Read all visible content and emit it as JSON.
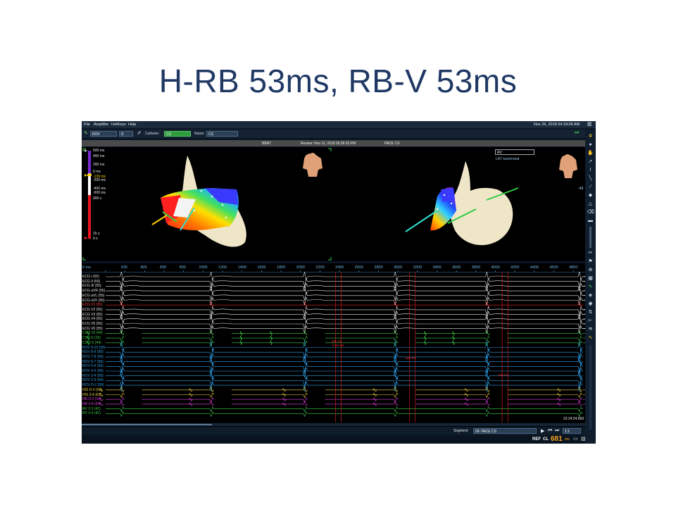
{
  "slide": {
    "title": "H-RB 53ms, RB-V 53ms"
  },
  "menu": {
    "items": [
      "File",
      "Amplifier",
      "HotKeys",
      "Help"
    ],
    "datetime": "Nov 26, 2018 04:18:06 AM"
  },
  "toolbar": {
    "catheter_select": "ROV",
    "mode_select": "D",
    "catheter_label": "Catheter:",
    "catheter_value": "CS",
    "name_label": "Name:",
    "name_value": "CS"
  },
  "infobar": {
    "map_name": "BBRT",
    "review": "Review: Nov 11, 2018 06:36:25 PM",
    "pace": "PACE CS"
  },
  "map_view": {
    "right_select": "RV",
    "right_mode": "LAT Isochronal",
    "scale_labels": [
      "500 ms",
      "400 ms",
      "200 ms",
      "0 ms",
      "-139 ms",
      "-200 ms",
      "-400 ms",
      "-500 ms",
      "999 s",
      "15 s",
      "0 s"
    ],
    "vertical_label": "-48"
  },
  "ecg_view": {
    "time_unit": "ms",
    "time_ticks": [
      "0 ms",
      "200",
      "400",
      "600",
      "800",
      "1000",
      "1200",
      "1400",
      "1600",
      "1800",
      "2000",
      "2200",
      "2400",
      "2600",
      "2800",
      "3000",
      "3200",
      "3400",
      "3600",
      "3800",
      "4000",
      "4200",
      "4400",
      "4600",
      "4800"
    ],
    "channels": [
      {
        "label": "ECG I (55)",
        "color": "#e6e6e6"
      },
      {
        "label": "ECG II (55)",
        "color": "#e6e6e6"
      },
      {
        "label": "ECG III (55)",
        "color": "#e6e6e6"
      },
      {
        "label": "ECG aVR (55)",
        "color": "#e6e6e6"
      },
      {
        "label": "ECG aVL (55)",
        "color": "#e6e6e6"
      },
      {
        "label": "ECG aVF (55)",
        "color": "#e6e6e6"
      },
      {
        "label": "ECG V1 (55)",
        "color": "#ff4040"
      },
      {
        "label": "ECG V2 (55)",
        "color": "#e6e6e6"
      },
      {
        "label": "ECG V3 (55)",
        "color": "#e6e6e6"
      },
      {
        "label": "ECG V4 (55)",
        "color": "#e6e6e6"
      },
      {
        "label": "ECG V5 (55)",
        "color": "#e6e6e6"
      },
      {
        "label": "ECG V6 (55)",
        "color": "#e6e6e6"
      },
      {
        "label": "CS 9-10 (44)",
        "color": "#3ecf4a"
      },
      {
        "label": "CS 5-6 (15)",
        "color": "#3ecf4a"
      },
      {
        "label": "CS D-2 (44)",
        "color": "#3ecf4a"
      },
      {
        "label": "ROV 9-10 (58)",
        "color": "#2f9fe8"
      },
      {
        "label": "ROV 8-9 (58)",
        "color": "#2f9fe8"
      },
      {
        "label": "ROV 7-8 (58)",
        "color": "#2f9fe8"
      },
      {
        "label": "ROV 6-7 (58)",
        "color": "#2f9fe8"
      },
      {
        "label": "ROV 5-6 (58)",
        "color": "#2f9fe8"
      },
      {
        "label": "ROV 4-5 (58)",
        "color": "#2f9fe8"
      },
      {
        "label": "ROV 3-4 (58)",
        "color": "#2f9fe8"
      },
      {
        "label": "ROV 2-3 (58)",
        "color": "#2f9fe8"
      },
      {
        "label": "ROV D-2 (58)",
        "color": "#2f9fe8"
      },
      {
        "label": "HIS D-2 (61)",
        "color": "#f2d13a"
      },
      {
        "label": "HIS 3-4 (61)",
        "color": "#f2d13a"
      },
      {
        "label": "RB D-2 (34)",
        "color": "#e040e0"
      },
      {
        "label": "RB 3-4 (34)",
        "color": "#e040e0"
      },
      {
        "label": "RV 2-3 (42)",
        "color": "#3ecf4a"
      },
      {
        "label": "RV 3-4 (42)",
        "color": "#3ecf4a"
      }
    ],
    "beat_times_ms": [
      170,
      1090,
      2050,
      2980,
      3920,
      4870
    ],
    "markers": [
      {
        "time": "2360",
        "label": "160 ms",
        "label2": "-3.92 mV"
      },
      {
        "time": "3120",
        "label": "160 ms",
        "label2": ""
      },
      {
        "time": "4070",
        "label": "160 ms",
        "label2": ""
      }
    ],
    "timestamp": "22:24:24.893"
  },
  "footer": {
    "segment_label": "Segment:",
    "segment_value": "09: PACE CS",
    "speed": "1:1",
    "ref_label": "REF",
    "cl_label": "CL",
    "cl_value": "681",
    "cl_unit": "ms"
  },
  "colors": {
    "accent": "#f5a623",
    "title": "#1f3864",
    "app_bg": "#0b1624"
  }
}
